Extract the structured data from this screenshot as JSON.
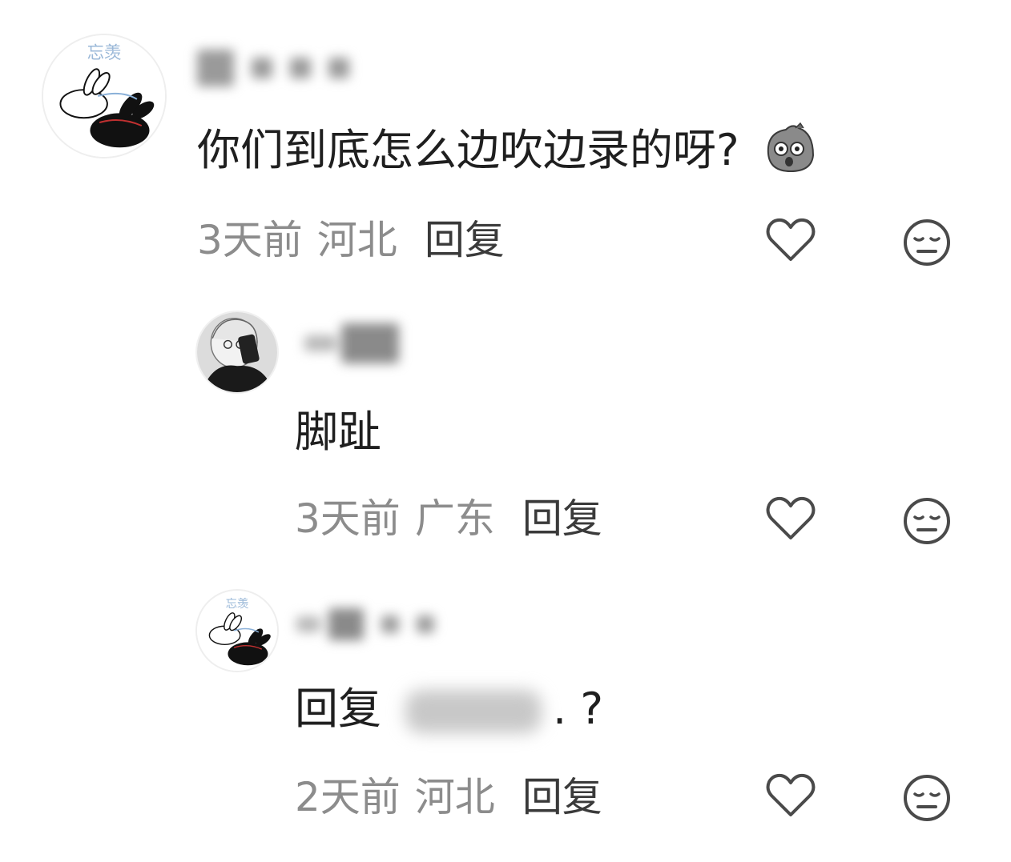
{
  "comments": [
    {
      "content": "你们到底怎么边吹边录的呀?",
      "emoji": "shocked-potato-emoji",
      "time": "3天前",
      "location": "河北",
      "reply_label": "回复"
    },
    {
      "content": "脚趾",
      "time": "3天前",
      "location": "广东",
      "reply_label": "回复"
    },
    {
      "content_prefix": "回复",
      "content_suffix": ". ?",
      "time": "2天前",
      "location": "河北",
      "reply_label": "回复"
    }
  ],
  "icons": {
    "like": "heart-outline-icon",
    "dislike": "neutral-face-icon"
  },
  "avatars": {
    "avatar_text": "忘羡"
  },
  "colors": {
    "meta_gray": "#8c8c8c",
    "text_dark": "#1f1f1f",
    "icon_gray": "#4a4a4a"
  }
}
